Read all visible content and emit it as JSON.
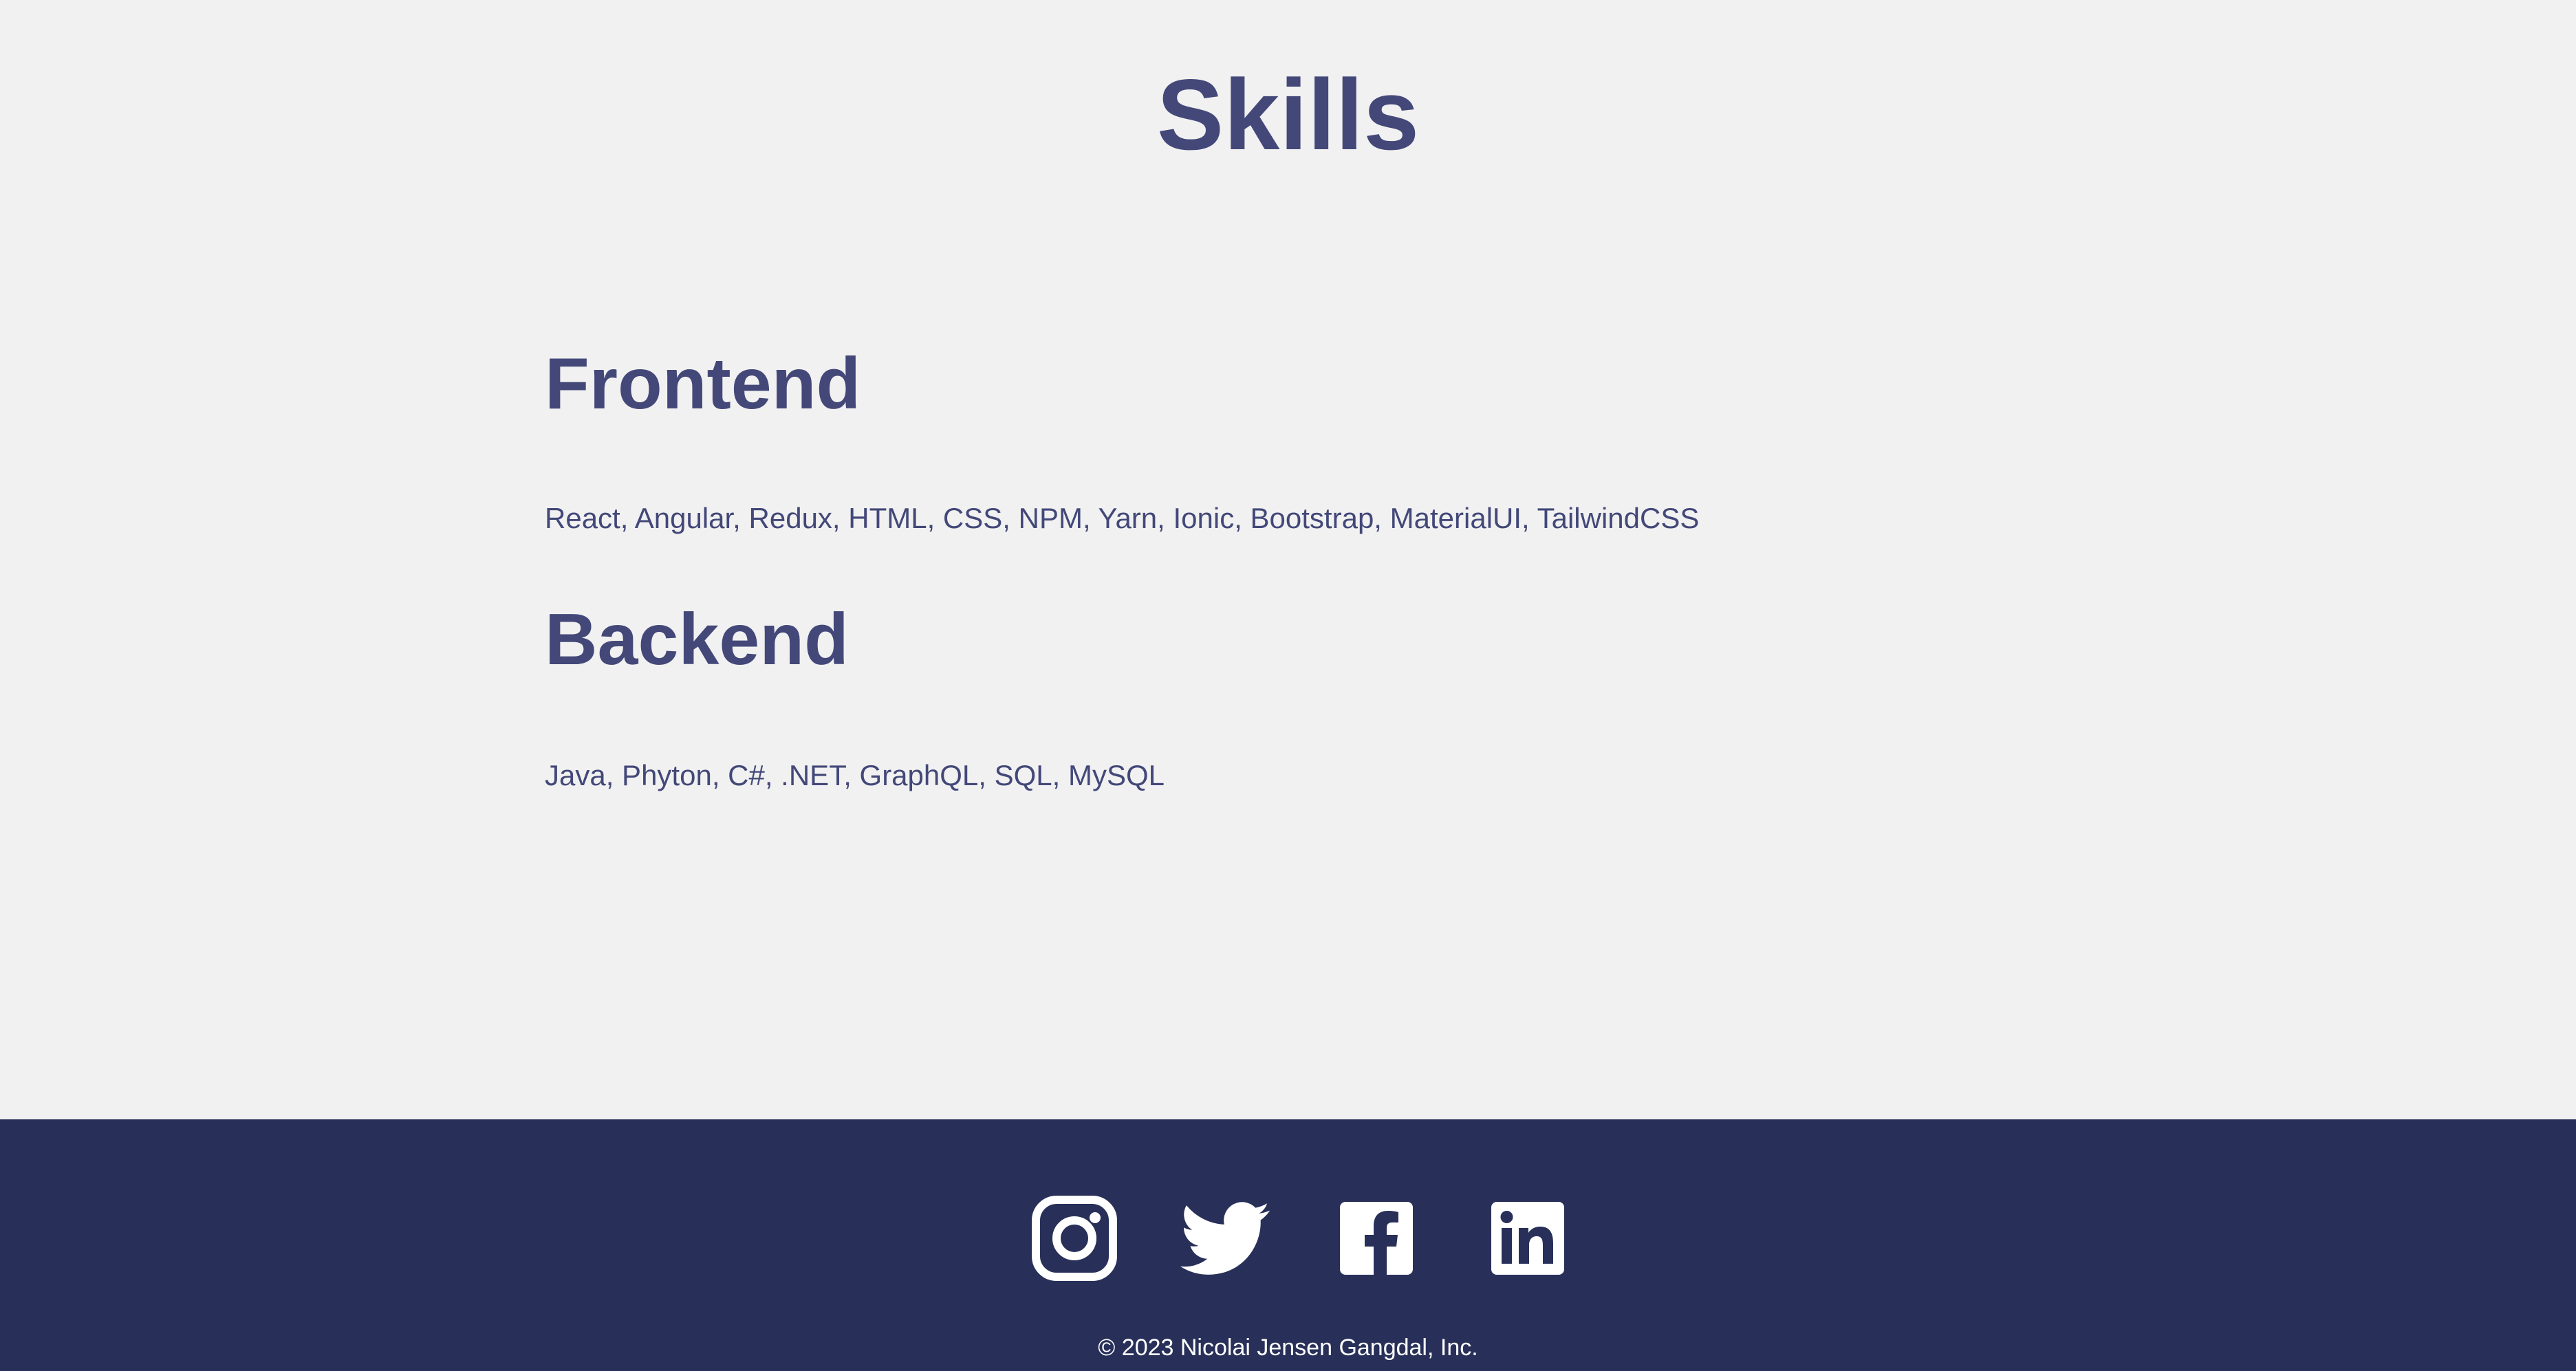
{
  "page": {
    "title": "Skills"
  },
  "sections": [
    {
      "heading": "Frontend",
      "text": "React, Angular, Redux, HTML, CSS, NPM, Yarn, Ionic, Bootstrap, MaterialUI, TailwindCSS"
    },
    {
      "heading": "Backend",
      "text": "Java, Phyton, C#, .NET, GraphQL, SQL, MySQL"
    }
  ],
  "footer": {
    "social": [
      {
        "icon": "instagram-icon"
      },
      {
        "icon": "twitter-icon"
      },
      {
        "icon": "facebook-icon"
      },
      {
        "icon": "linkedin-icon"
      }
    ],
    "copyright": "© 2023 Nicolai Jensen Gangdal, Inc."
  },
  "colors": {
    "background": "#f1f1f1",
    "text_accent": "#434879",
    "footer_background": "#283059",
    "footer_text": "#ffffff"
  }
}
